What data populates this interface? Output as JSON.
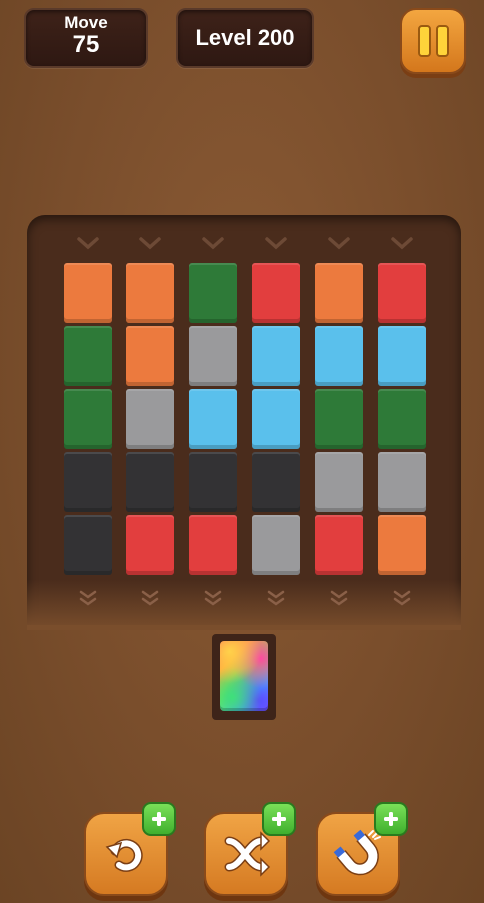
{
  "hud": {
    "move_label": "Move",
    "move_value": "75",
    "level_text": "Level 200"
  },
  "colors": {
    "orange": "#ec7a3e",
    "green": "#2e7a38",
    "gray": "#9a9a9c",
    "blue": "#5ac0ec",
    "red": "#e23e3e",
    "black": "#333234"
  },
  "columns": [
    [
      "orange",
      "green",
      "green",
      "black",
      "black"
    ],
    [
      "orange",
      "orange",
      "gray",
      "black",
      "red"
    ],
    [
      "green",
      "gray",
      "blue",
      "black",
      "red"
    ],
    [
      "red",
      "blue",
      "blue",
      "black",
      "gray"
    ],
    [
      "orange",
      "blue",
      "green",
      "gray",
      "red"
    ],
    [
      "red",
      "blue",
      "green",
      "gray",
      "orange"
    ]
  ],
  "slot": {
    "tile": "rainbow"
  },
  "boosters": [
    {
      "name": "undo",
      "icon": "undo-icon"
    },
    {
      "name": "shuffle",
      "icon": "shuffle-icon"
    },
    {
      "name": "magnet",
      "icon": "magnet-icon"
    }
  ]
}
